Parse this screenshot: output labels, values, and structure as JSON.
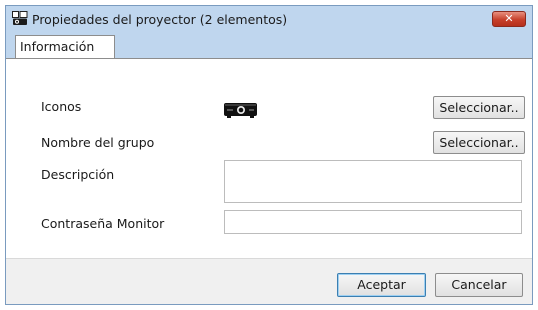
{
  "window": {
    "title": "Propiedades del proyector (2 elementos)",
    "close_glyph": "✕"
  },
  "tabs": [
    {
      "label": "Información",
      "active": true
    }
  ],
  "form": {
    "icons_label": "Iconos",
    "icon_name": "projector-icon",
    "icons_button": "Seleccionar..",
    "group_label": "Nombre del grupo",
    "group_button": "Seleccionar..",
    "description_label": "Descripción",
    "description_value": "",
    "password_label": "Contraseña Monitor",
    "password_value": ""
  },
  "footer": {
    "ok_label": "Aceptar",
    "cancel_label": "Cancelar"
  },
  "colors": {
    "titlebar": "#bfd6ee",
    "close_button": "#c7402b",
    "primary_border": "#3c7fb1"
  }
}
